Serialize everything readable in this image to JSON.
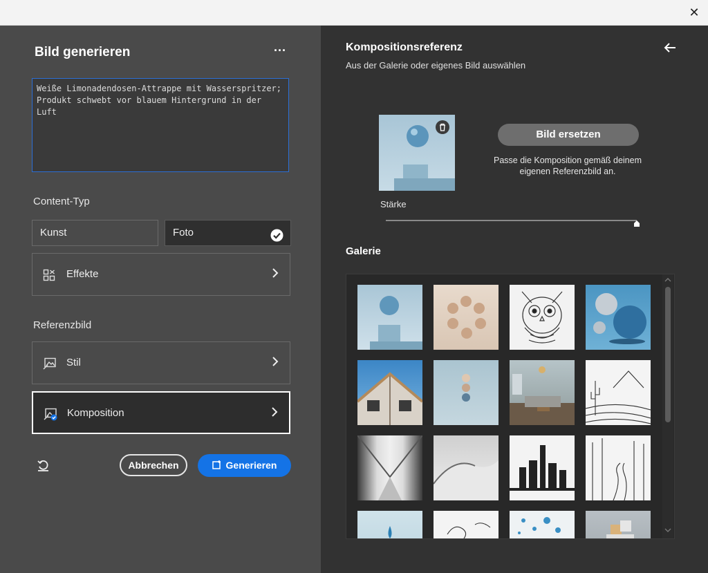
{
  "window": {
    "close_label": "✕"
  },
  "left": {
    "title": "Bild generieren",
    "more_label": "···",
    "prompt_text": "Weiße Limonadendosen-Attrappe mit Wasserspritzer; Produkt schwebt vor blauem Hintergrund in der Luft",
    "content_type_heading": "Content-Typ",
    "content_types": [
      {
        "label": "Kunst",
        "selected": false
      },
      {
        "label": "Foto",
        "selected": true
      }
    ],
    "effects_label": "Effekte",
    "reference_heading": "Referenzbild",
    "style_label": "Stil",
    "composition_label": "Komposition",
    "cancel_label": "Abbrechen",
    "generate_label": "Generieren"
  },
  "right": {
    "title": "Kompositionsreferenz",
    "subtitle": "Aus der Galerie oder eigenes Bild auswählen",
    "replace_label": "Bild ersetzen",
    "replace_hint": "Passe die Komposition gemäß deinem eigenen Referenzbild an.",
    "strength_label": "Stärke",
    "strength_value": 1.0,
    "gallery_heading": "Galerie",
    "gallery": [
      {
        "name": "floating-sphere-on-cube"
      },
      {
        "name": "floating-beige-spheres-circle"
      },
      {
        "name": "owl-line-art"
      },
      {
        "name": "blue-spheres-3d"
      },
      {
        "name": "modern-architecture-corner"
      },
      {
        "name": "stacked-balls-on-wall"
      },
      {
        "name": "living-room-interior"
      },
      {
        "name": "cactus-mountain-line-art"
      },
      {
        "name": "architecture-perspective-lines"
      },
      {
        "name": "desert-dunes"
      },
      {
        "name": "city-skyline-sketch"
      },
      {
        "name": "forest-path-line-art"
      },
      {
        "name": "water-drop-blue"
      },
      {
        "name": "swan-line-art"
      },
      {
        "name": "blue-droplets-white"
      },
      {
        "name": "cubes-on-pedestal"
      }
    ]
  },
  "colors": {
    "accent": "#1473e6",
    "left_bg": "#4a4a4a",
    "right_bg": "#323232"
  }
}
